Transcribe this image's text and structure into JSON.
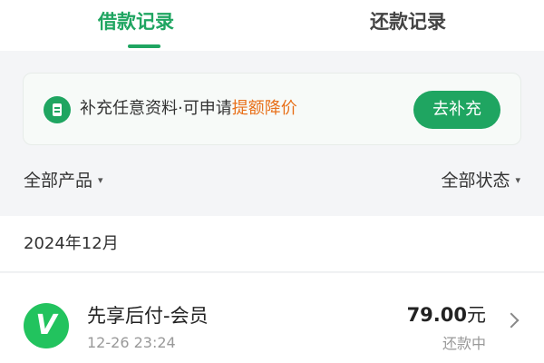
{
  "tabs": {
    "borrow_label": "借款记录",
    "repay_label": "还款记录",
    "active_color": "#1fa561"
  },
  "banner": {
    "icon": "document-icon",
    "text_prefix": "补充任意资料·可申请",
    "text_highlight": "提额降价",
    "button_label": "去补充",
    "highlight_color": "#e8701a"
  },
  "filters": {
    "products_label": "全部产品",
    "status_label": "全部状态",
    "caret_icon": "▾"
  },
  "month": {
    "label": "2024年12月"
  },
  "records": [
    {
      "logo_letter": "V",
      "name": "先享后付-会员",
      "time": "12-26 23:24",
      "amount": "79.00",
      "currency": "元",
      "status": "还款中"
    }
  ]
}
